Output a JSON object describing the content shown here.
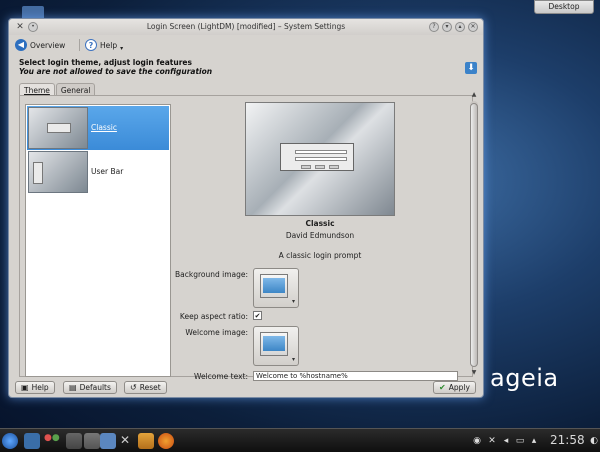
{
  "desktop": {
    "desktop_button": "Desktop",
    "brand": "ageia"
  },
  "window": {
    "title": "Login Screen (LightDM) [modified] – System Settings",
    "toolbar": {
      "overview_label": "Overview",
      "help_label": "Help"
    },
    "header": {
      "title": "Select login theme, adjust login features",
      "subtitle": "You are not allowed to save the configuration"
    },
    "tabs": [
      {
        "label": "Theme",
        "active": true
      },
      {
        "label": "General",
        "active": false
      }
    ],
    "themes": [
      {
        "name": "Classic",
        "selected": true
      },
      {
        "name": "User Bar",
        "selected": false
      }
    ],
    "preview": {
      "title": "Classic",
      "author": "David Edmundson",
      "description": "A classic login prompt"
    },
    "form": {
      "background_image_label": "Background image:",
      "keep_aspect_label": "Keep aspect ratio:",
      "keep_aspect_checked": "✔",
      "welcome_image_label": "Welcome image:",
      "welcome_text_label": "Welcome text:",
      "welcome_text_value": "Welcome to %hostname%"
    },
    "buttons": {
      "help": "Help",
      "defaults": "Defaults",
      "reset": "Reset",
      "apply": "Apply"
    }
  },
  "taskbar": {
    "clock": "21:58"
  },
  "colors": {
    "selection": "#3b8bd8",
    "window_bg": "#d6d3cf",
    "desktop_bg": "#1d3e6a"
  }
}
